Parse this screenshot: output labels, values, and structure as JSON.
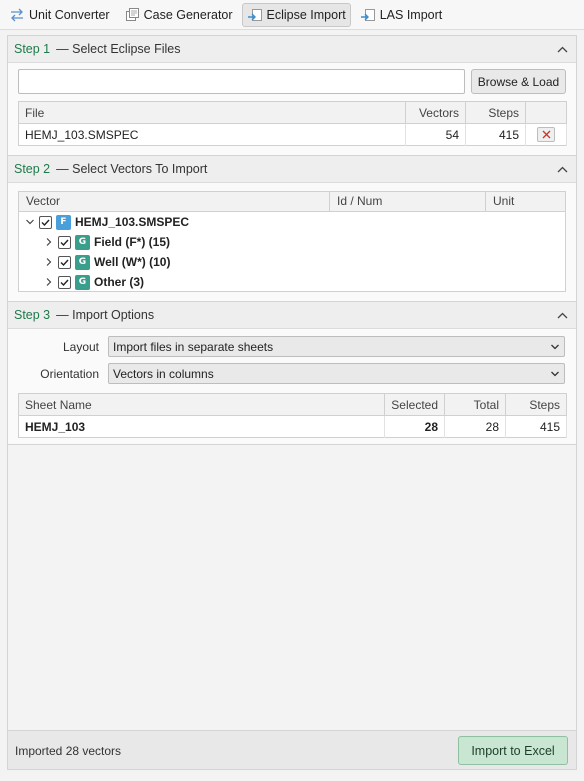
{
  "toolbar": {
    "tabs": [
      {
        "label": "Unit Converter",
        "icon": "unit-converter-icon"
      },
      {
        "label": "Case Generator",
        "icon": "case-generator-icon"
      },
      {
        "label": "Eclipse Import",
        "icon": "eclipse-import-icon",
        "active": true
      },
      {
        "label": "LAS Import",
        "icon": "las-import-icon"
      }
    ]
  },
  "step1": {
    "step": "Step 1",
    "title": "— Select Eclipse Files",
    "path_value": "",
    "browse_label": "Browse & Load",
    "columns": [
      "File",
      "Vectors",
      "Steps",
      ""
    ],
    "rows": [
      {
        "file": "HEMJ_103.SMSPEC",
        "vectors": "54",
        "steps": "415"
      }
    ]
  },
  "step2": {
    "step": "Step 2",
    "title": "— Select Vectors To Import",
    "columns": [
      "Vector",
      "Id / Num",
      "Unit"
    ],
    "tree": {
      "root": {
        "badge": "F",
        "label": "HEMJ_103.SMSPEC",
        "checked": true
      },
      "children": [
        {
          "badge": "G",
          "label": "Field (F*) (15)",
          "checked": true
        },
        {
          "badge": "G",
          "label": "Well (W*) (10)",
          "checked": true
        },
        {
          "badge": "G",
          "label": "Other (3)",
          "checked": true
        }
      ]
    }
  },
  "step3": {
    "step": "Step 3",
    "title": "— Import Options",
    "layout_label": "Layout",
    "layout_value": "Import files in separate sheets",
    "orientation_label": "Orientation",
    "orientation_value": "Vectors in columns",
    "columns": [
      "Sheet Name",
      "Selected",
      "Total",
      "Steps"
    ],
    "rows": [
      {
        "sheet": "HEMJ_103",
        "selected": "28",
        "total": "28",
        "steps": "415"
      }
    ]
  },
  "footer": {
    "status": "Imported 28 vectors",
    "import_label": "Import to Excel"
  },
  "colors": {
    "accent_green": "#1e7a4a",
    "import_button_bg": "#c8e6d2",
    "badge_file": "#4a9ed9",
    "badge_group": "#3a9e8c"
  }
}
